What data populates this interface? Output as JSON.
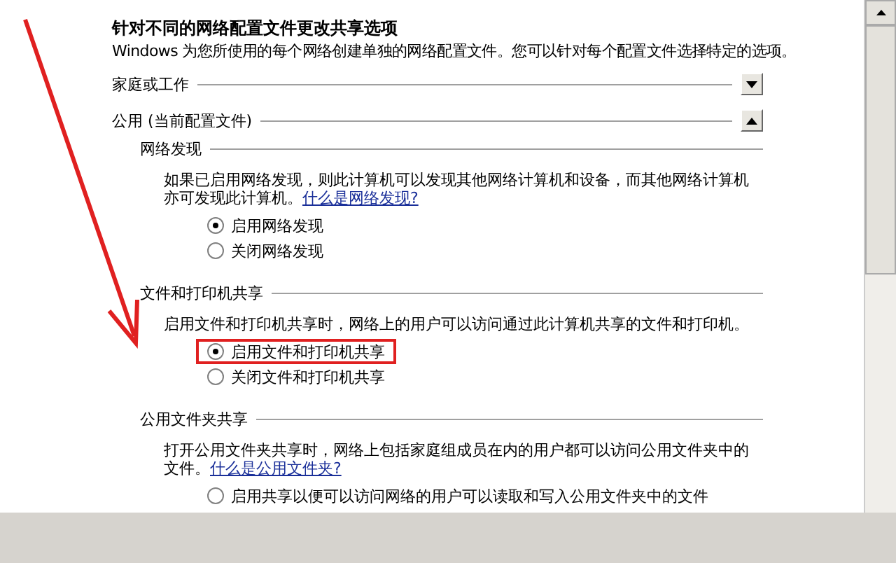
{
  "heading": "针对不同的网络配置文件更改共享选项",
  "description": "Windows 为您所使用的每个网络创建单独的网络配置文件。您可以针对每个配置文件选择特定的选项。",
  "profiles": [
    {
      "label": "家庭或工作",
      "expanded": false
    },
    {
      "label": "公用 (当前配置文件)",
      "expanded": true,
      "sections": [
        {
          "title": "网络发现",
          "text": "如果已启用网络发现，则此计算机可以发现其他网络计算机和设备，而其他网络计算机亦可发现此计算机。",
          "link": "什么是网络发现?",
          "options": [
            {
              "label": "启用网络发现",
              "selected": true,
              "highlighted": false
            },
            {
              "label": "关闭网络发现",
              "selected": false,
              "highlighted": false
            }
          ]
        },
        {
          "title": "文件和打印机共享",
          "text": "启用文件和打印机共享时，网络上的用户可以访问通过此计算机共享的文件和打印机。",
          "options": [
            {
              "label": "启用文件和打印机共享",
              "selected": true,
              "highlighted": true
            },
            {
              "label": "关闭文件和打印机共享",
              "selected": false,
              "highlighted": false
            }
          ]
        },
        {
          "title": "公用文件夹共享",
          "text": "打开公用文件夹共享时，网络上包括家庭组成员在内的用户都可以访问公用文件夹中的文件。",
          "link": "什么是公用文件夹?",
          "options": [
            {
              "label": "启用共享以便可以访问网络的用户可以读取和写入公用文件夹中的文件",
              "selected": false,
              "highlighted": false
            }
          ]
        }
      ]
    }
  ]
}
